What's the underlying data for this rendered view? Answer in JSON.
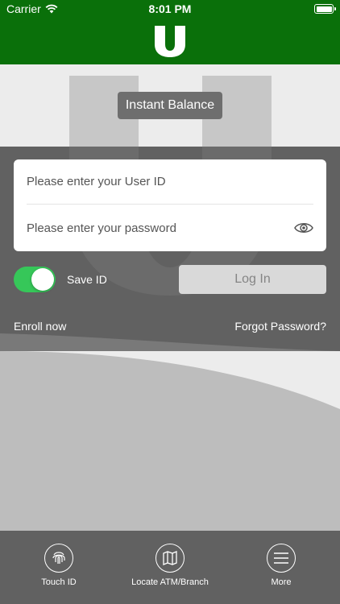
{
  "status_bar": {
    "carrier": "Carrier",
    "time": "8:01 PM"
  },
  "header": {
    "logo_icon": "u-logo-icon",
    "brand_color": "#0a700a"
  },
  "hero": {
    "instant_balance_label": "Instant Balance"
  },
  "login": {
    "user_id_placeholder": "Please enter your User ID",
    "password_placeholder": "Please enter your password",
    "show_password_icon": "eye-icon",
    "save_id_label": "Save ID",
    "save_id_enabled": true,
    "toggle_color": "#36c759",
    "login_button_label": "Log In",
    "enroll_label": "Enroll now",
    "forgot_label": "Forgot Password?"
  },
  "tab_bar": {
    "items": [
      {
        "label": "Touch ID",
        "icon": "fingerprint-icon"
      },
      {
        "label": "Locate ATM/Branch",
        "icon": "map-icon"
      },
      {
        "label": "More",
        "icon": "menu-icon"
      }
    ]
  }
}
